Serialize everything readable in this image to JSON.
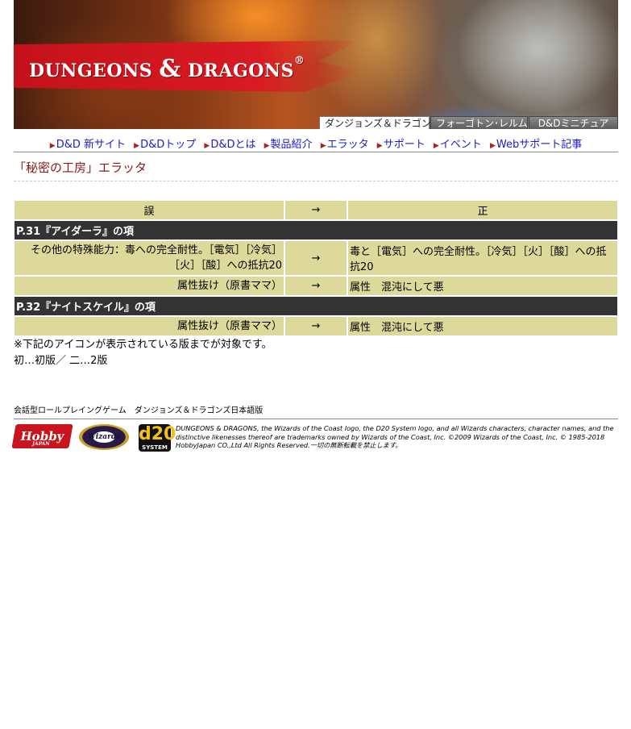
{
  "banner": {
    "logo_text": "DUNGEONS",
    "logo_amp": "&",
    "logo_text2": "DRAGONS",
    "logo_reg": "®"
  },
  "tabs": [
    {
      "label": "ダンジョンズ＆ドラゴンズ",
      "active": true
    },
    {
      "label": "フォーゴトン･レルム",
      "active": false
    },
    {
      "label": "D&Dミニチュア",
      "active": false
    }
  ],
  "nav": [
    "D&D 新サイト",
    "D&Dトップ",
    "D&Dとは",
    "製品紹介",
    "エラッタ",
    "サポート",
    "イベント",
    "Webサポート記事"
  ],
  "page_title": "「秘密の工房」エラッタ",
  "errata": {
    "header": {
      "wrong": "誤",
      "arrow": "→",
      "right": "正"
    },
    "sections": [
      {
        "title": "P.31『アイダーラ』の項",
        "rows": [
          {
            "wrong": "その他の特殊能力：毒への完全耐性。［電気］［冷気］［火］［酸］への抵抗20",
            "arrow": "→",
            "right": "毒と［電気］への完全耐性。［冷気］［火］［酸］への抵抗20"
          },
          {
            "wrong": "属性抜け（原書ママ）",
            "arrow": "→",
            "right": "属性　混沌にして悪"
          }
        ]
      },
      {
        "title": "P.32『ナイトスケイル』の項",
        "rows": [
          {
            "wrong": "属性抜け（原書ママ）",
            "arrow": "→",
            "right": "属性　混沌にして悪"
          }
        ]
      }
    ]
  },
  "notes": {
    "line1": "※下記のアイコンが表示されている版までが対象です。",
    "line2": "初…初版／ 二…2版"
  },
  "footer": {
    "caption": "会話型ロールプレイングゲーム　ダンジョンズ＆ドラゴンズ日本語版",
    "hobby_logo": "Hobby",
    "hobby_sub": "JAPAN",
    "wizards_logo": "Wizards",
    "d20_logo": "d20",
    "d20_sub": "SYSTEM",
    "legal": "DUNGEONS & DRAGONS, the Wizards of the Coast logo, the D20 System logo, and all Wizards characters, character names, and the distinctive likenesses thereof are trademarks owned by Wizards of the Coast, Inc. ©2009 Wizards of the Coast, Inc. © 1985-2018 HobbyJapan CO.,Ltd All Rights Reserved.一切の無断転載を禁止します。"
  },
  "colors": {
    "accent_red": "#8c1a14",
    "table_cell": "#dcd99b",
    "section_bg": "#333333",
    "link": "#1a1acd"
  }
}
